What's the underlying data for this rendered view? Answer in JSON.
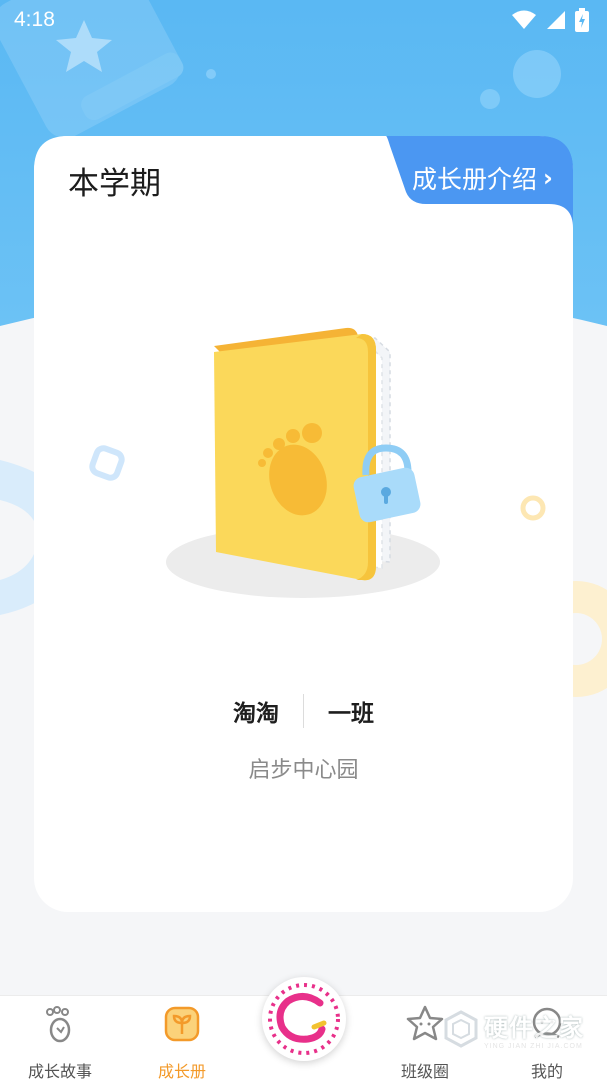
{
  "status_bar": {
    "time": "4:18"
  },
  "card": {
    "title": "本学期",
    "intro_link_label": "成长册介绍",
    "intro_link_chevron": "›"
  },
  "student": {
    "name": "淘淘",
    "class_name": "一班",
    "school": "启步中心园"
  },
  "bottom_nav": {
    "items": [
      {
        "label": "成长故事",
        "icon": "footprint-icon",
        "active": false
      },
      {
        "label": "成长册",
        "icon": "sprout-book-icon",
        "active": true
      },
      {
        "label": "班级圈",
        "icon": "star-face-icon",
        "active": false
      },
      {
        "label": "我的",
        "icon": "profile-icon",
        "active": false
      }
    ],
    "center_icon": "brand-logo-icon"
  },
  "watermark": {
    "title": "硬件之家",
    "subtitle": "YING JIAN ZHI JIA.COM"
  },
  "colors": {
    "hero_blue": "#5ab8f3",
    "tab_blue": "#4b97f2",
    "active_orange": "#f39a2a",
    "book_yellow": "#fbd85a"
  }
}
